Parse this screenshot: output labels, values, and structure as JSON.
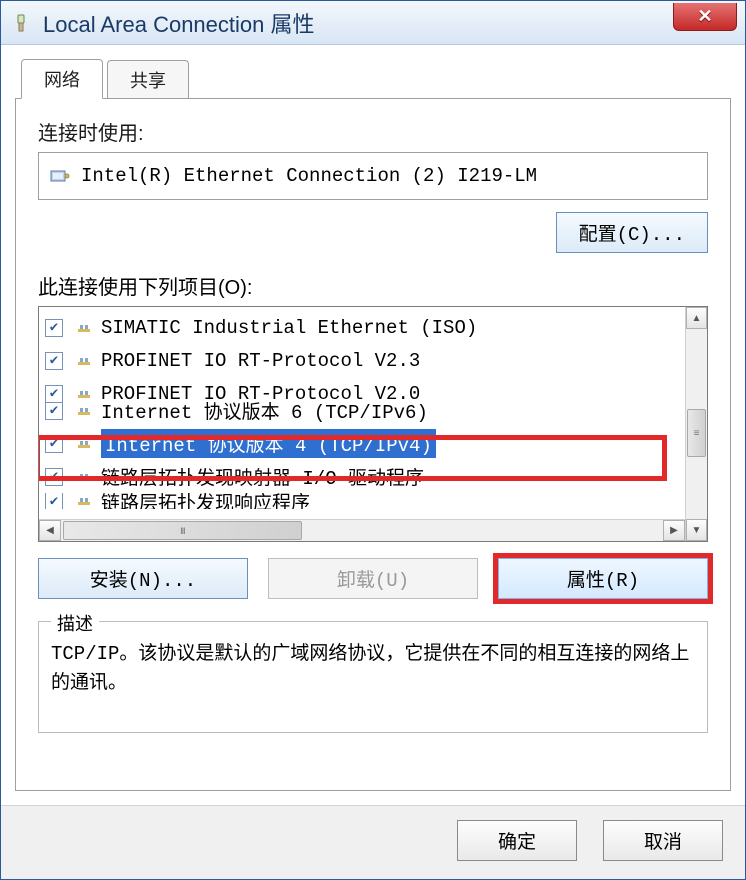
{
  "window": {
    "title": "Local Area Connection 属性"
  },
  "tabs": {
    "network": "网络",
    "sharing": "共享"
  },
  "connect_using_label": "连接时使用:",
  "adapter_name": "Intel(R) Ethernet Connection (2) I219-LM",
  "configure_btn": "配置(C)...",
  "items_label": "此连接使用下列项目(O):",
  "list": [
    {
      "checked": true,
      "label": "SIMATIC Industrial Ethernet (ISO)",
      "selected": false
    },
    {
      "checked": true,
      "label": "PROFINET IO RT-Protocol V2.3",
      "selected": false
    },
    {
      "checked": true,
      "label": "PROFINET IO RT-Protocol V2.0",
      "selected": false
    },
    {
      "checked": true,
      "label": "Internet 协议版本 6 (TCP/IPv6)",
      "selected": false,
      "cut": "top"
    },
    {
      "checked": true,
      "label": "Internet 协议版本 4 (TCP/IPv4)",
      "selected": true
    },
    {
      "checked": true,
      "label": "链路层拓扑发现映射器 I/O 驱动程序",
      "selected": false
    },
    {
      "checked": true,
      "label": "链路层拓扑发现响应程序",
      "selected": false,
      "cut": "bottom"
    }
  ],
  "buttons": {
    "install": "安装(N)...",
    "uninstall": "卸载(U)",
    "properties": "属性(R)"
  },
  "desc_legend": "描述",
  "desc_text": "TCP/IP。该协议是默认的广域网络协议，它提供在不同的相互连接的网络上的通讯。",
  "footer": {
    "ok": "确定",
    "cancel": "取消"
  }
}
